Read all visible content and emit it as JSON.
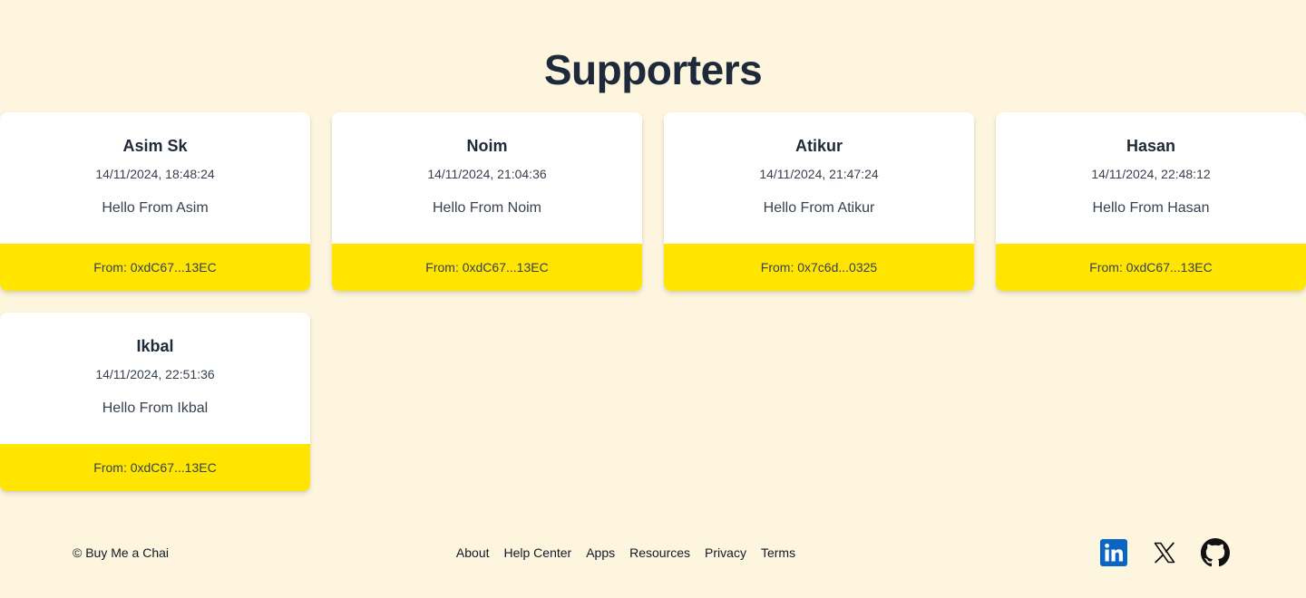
{
  "page": {
    "title": "Supporters"
  },
  "supporters": [
    {
      "name": "Asim Sk",
      "time": "14/11/2024, 18:48:24",
      "message": "Hello From Asim",
      "from": "From: 0xdC67...13EC"
    },
    {
      "name": "Noim",
      "time": "14/11/2024, 21:04:36",
      "message": "Hello From Noim",
      "from": "From: 0xdC67...13EC"
    },
    {
      "name": "Atikur",
      "time": "14/11/2024, 21:47:24",
      "message": "Hello From Atikur",
      "from": "From: 0x7c6d...0325"
    },
    {
      "name": "Hasan",
      "time": "14/11/2024, 22:48:12",
      "message": "Hello From Hasan",
      "from": "From: 0xdC67...13EC"
    },
    {
      "name": "Ikbal",
      "time": "14/11/2024, 22:51:36",
      "message": "Hello From Ikbal",
      "from": "From: 0xdC67...13EC"
    }
  ],
  "footer": {
    "copyright": "© Buy Me a Chai",
    "links": [
      "About",
      "Help Center",
      "Apps",
      "Resources",
      "Privacy",
      "Terms"
    ],
    "social": [
      {
        "icon": "linkedin-icon",
        "color": "#0a66c2"
      },
      {
        "icon": "x-icon",
        "color": "#111111"
      },
      {
        "icon": "github-icon",
        "color": "#111111"
      }
    ]
  },
  "colors": {
    "background": "#fdf5dd",
    "card_footer": "#ffe500",
    "title": "#1e293b"
  }
}
